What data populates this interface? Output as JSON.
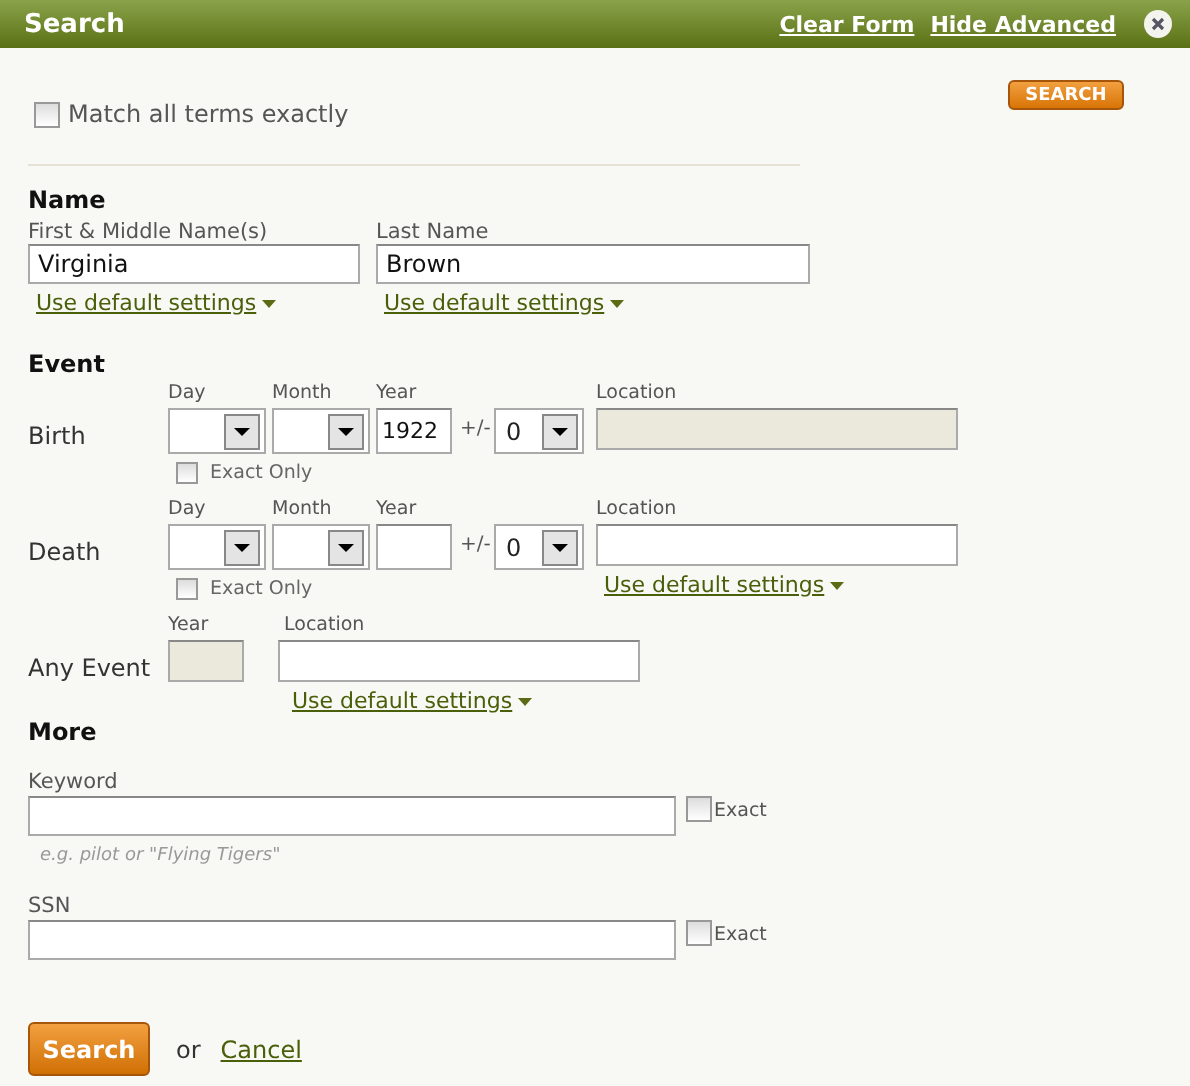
{
  "header": {
    "title": "Search",
    "links": [
      "Clear Form",
      "Hide Advanced"
    ]
  },
  "top_button": "SEARCH",
  "match_exact": {
    "label": "Match all terms exactly",
    "checked": false
  },
  "name": {
    "heading": "Name",
    "fields": [
      {
        "label": "First & Middle Name(s)",
        "value": "Virginia",
        "link": "Use default settings"
      },
      {
        "label": "Last Name",
        "value": "Brown",
        "link": "Use default settings"
      }
    ]
  },
  "event": {
    "heading": "Event",
    "rows": [
      {
        "kind": "date",
        "label": "Birth",
        "day_label": "Day",
        "month_label": "Month",
        "year_label": "Year",
        "year_value": "1922",
        "range_label": "+/-",
        "range_value": "0",
        "location_label": "Location",
        "location_disabled": true,
        "exact_only": {
          "label": "Exact Only",
          "checked": false
        }
      },
      {
        "kind": "date",
        "label": "Death",
        "day_label": "Day",
        "month_label": "Month",
        "year_label": "Year",
        "range_label": "+/-",
        "range_value": "0",
        "location_label": "Location",
        "location_disabled": false,
        "exact_only": {
          "label": "Exact Only",
          "checked": false
        },
        "link": "Use default settings"
      },
      {
        "kind": "simple",
        "label": "Any Event",
        "year_label": "Year",
        "year_disabled": true,
        "location_label": "Location",
        "link": "Use default settings"
      }
    ]
  },
  "more": {
    "heading": "More",
    "fields": [
      {
        "label": "Keyword",
        "hint": "e.g. pilot or \"Flying Tigers\"",
        "exact": {
          "label": "Exact",
          "checked": false
        }
      },
      {
        "label": "SSN",
        "exact": {
          "label": "Exact",
          "checked": false
        }
      }
    ]
  },
  "footer": {
    "button": "Search",
    "or": "or",
    "cancel": "Cancel"
  }
}
